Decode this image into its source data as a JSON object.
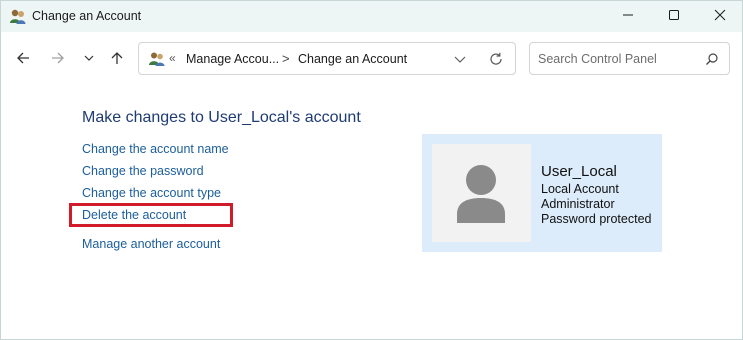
{
  "window": {
    "title": "Change an Account",
    "controls": {
      "minimize_icon": "minimize-icon",
      "maximize_icon": "maximize-icon",
      "close_icon": "close-icon"
    }
  },
  "nav": {
    "back_icon": "arrow-left-icon",
    "forward_icon": "arrow-right-icon",
    "recent_icon": "chevron-down-icon",
    "up_icon": "arrow-up-icon",
    "address": {
      "overflow": "«",
      "crumbs": [
        "Manage Accou...",
        "Change an Account"
      ],
      "separator": ">"
    },
    "search": {
      "placeholder": "Search Control Panel"
    }
  },
  "content": {
    "heading": "Make changes to User_Local's account",
    "links": [
      "Change the account name",
      "Change the password",
      "Change the account type",
      "Delete the account",
      "Manage another account"
    ],
    "highlight_color": "#d11a2a"
  },
  "account": {
    "name": "User_Local",
    "type": "Local Account",
    "role": "Administrator",
    "status": "Password protected"
  },
  "colors": {
    "titlebar": "#eef6f5",
    "link": "#1c5e9b",
    "heading": "#1e3b73",
    "panel": "#dcecfa"
  }
}
